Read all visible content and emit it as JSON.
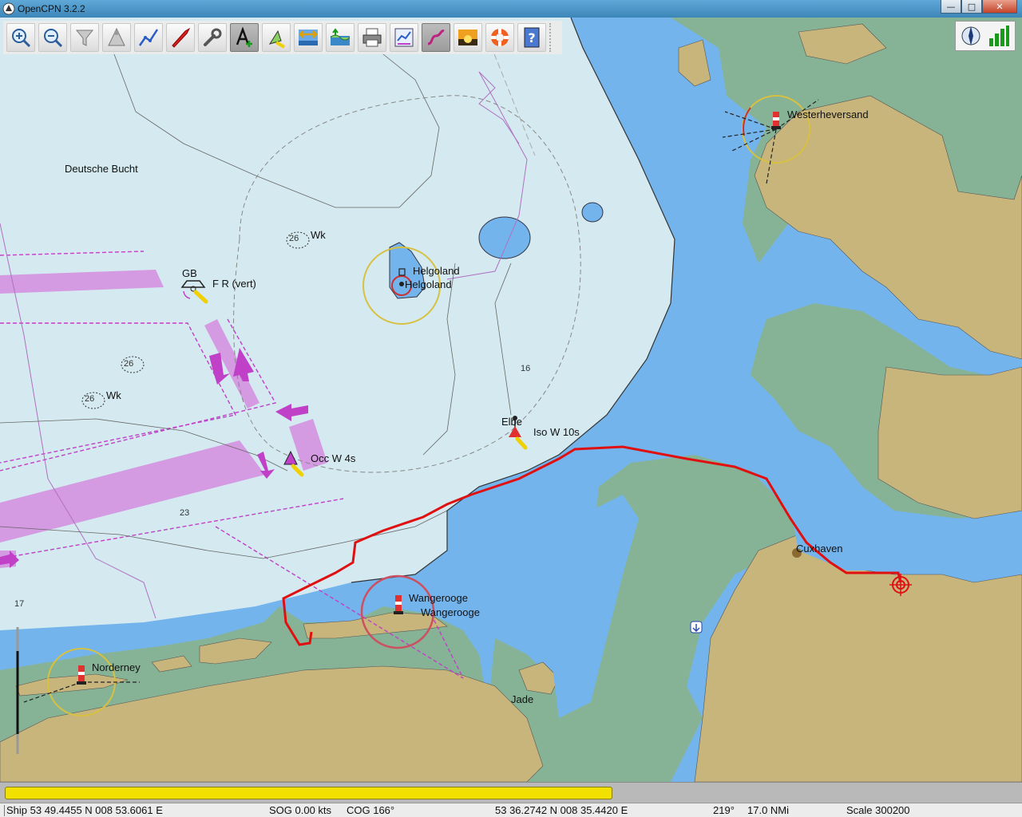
{
  "window": {
    "title": "OpenCPN 3.2.2"
  },
  "toolbar": {
    "buttons": [
      {
        "name": "zoom-in",
        "icon": "zoom-in-icon"
      },
      {
        "name": "zoom-out",
        "icon": "zoom-out-icon"
      },
      {
        "name": "scale-in",
        "icon": "funnel-icon"
      },
      {
        "name": "scale-out",
        "icon": "triangle-icon"
      },
      {
        "name": "route",
        "icon": "route-icon"
      },
      {
        "name": "follow-ship",
        "icon": "boat-icon"
      },
      {
        "name": "settings",
        "icon": "wrench-icon"
      },
      {
        "name": "text",
        "icon": "text-add-icon"
      },
      {
        "name": "ais",
        "icon": "ais-icon"
      },
      {
        "name": "current",
        "icon": "current-icon"
      },
      {
        "name": "tide",
        "icon": "tide-icon"
      },
      {
        "name": "print",
        "icon": "printer-icon"
      },
      {
        "name": "route-manager",
        "icon": "route-manager-icon"
      },
      {
        "name": "track",
        "icon": "track-icon"
      },
      {
        "name": "color-scheme",
        "icon": "sunset-icon"
      },
      {
        "name": "mob",
        "icon": "lifebuoy-icon"
      },
      {
        "name": "help",
        "icon": "help-icon"
      }
    ]
  },
  "chart": {
    "labels": {
      "deutsche_bucht": "Deutsche Bucht",
      "westerheversand": "Westerheversand",
      "wk1": "Wk",
      "wk2": "Wk",
      "gb": "GB",
      "fr_vert": "F R (vert)",
      "helgoland1": "Helgoland",
      "helgoland2": "Helgoland",
      "elbe": "Elbe",
      "iso": "Iso W 10s",
      "occ": "Occ W 4s",
      "wangerooge1": "Wangerooge",
      "wangerooge2": "Wangerooge",
      "norderney": "Norderney",
      "cuxhaven": "Cuxhaven",
      "jade": "Jade"
    },
    "depths": {
      "d16": "16",
      "d23": "23",
      "d17": "17",
      "w26a": "26",
      "w26b": "26",
      "w26c": "26",
      "w26sub": "2"
    },
    "colors": {
      "shallow": "#74b4ec",
      "deep": "#d4eaf0",
      "land": "#c8b57c",
      "intertidal": "#86b396",
      "track": "#e01010",
      "magenta": "#d088e0"
    }
  },
  "progress": {
    "fraction": 0.6
  },
  "status": {
    "ship": "Ship 53 49.4455 N   008 53.6061 E",
    "sog": "SOG 0.00 kts",
    "cog": "COG 166°",
    "cursor": "53 36.2742 N   008 35.4420 E",
    "bearing": "219°",
    "distance": "17.0 NMi",
    "scale": "Scale 300200"
  }
}
